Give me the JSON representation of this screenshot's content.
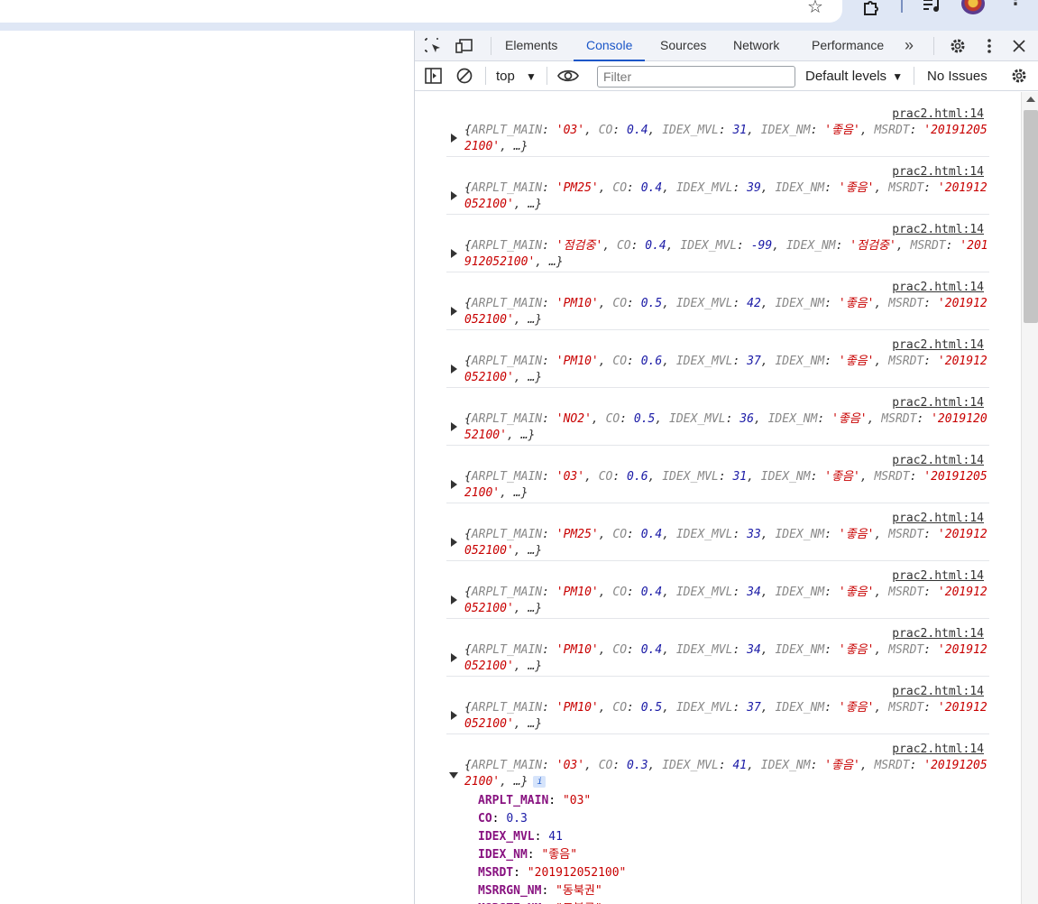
{
  "devtools": {
    "tabs": [
      "Elements",
      "Console",
      "Sources",
      "Network",
      "Performance"
    ],
    "active_tab": "Console",
    "more_tabs": "»",
    "context": "top",
    "filter_placeholder": "Filter",
    "levels": "Default levels",
    "issues": "No Issues"
  },
  "console": {
    "messages": [
      {
        "source": "prac2.html:14",
        "main": "'03'",
        "co": "0.4",
        "idx": "31",
        "nm": "'좋음'",
        "msrdt": "'201912052100'"
      },
      {
        "source": "prac2.html:14",
        "main": "'PM25'",
        "co": "0.4",
        "idx": "39",
        "nm": "'좋음'",
        "msrdt": "'201912052100'"
      },
      {
        "source": "prac2.html:14",
        "main": "'점검중'",
        "co": "0.4",
        "idx": "-99",
        "nm": "'점검중'",
        "msrdt": "'201912052100'"
      },
      {
        "source": "prac2.html:14",
        "main": "'PM10'",
        "co": "0.5",
        "idx": "42",
        "nm": "'좋음'",
        "msrdt": "'201912052100'"
      },
      {
        "source": "prac2.html:14",
        "main": "'PM10'",
        "co": "0.6",
        "idx": "37",
        "nm": "'좋음'",
        "msrdt": "'201912052100'"
      },
      {
        "source": "prac2.html:14",
        "main": "'NO2'",
        "co": "0.5",
        "idx": "36",
        "nm": "'좋음'",
        "msrdt": "'201912052100'"
      },
      {
        "source": "prac2.html:14",
        "main": "'03'",
        "co": "0.6",
        "idx": "31",
        "nm": "'좋음'",
        "msrdt": "'201912052100'"
      },
      {
        "source": "prac2.html:14",
        "main": "'PM25'",
        "co": "0.4",
        "idx": "33",
        "nm": "'좋음'",
        "msrdt": "'201912052100'"
      },
      {
        "source": "prac2.html:14",
        "main": "'PM10'",
        "co": "0.4",
        "idx": "34",
        "nm": "'좋음'",
        "msrdt": "'201912052100'"
      },
      {
        "source": "prac2.html:14",
        "main": "'PM10'",
        "co": "0.4",
        "idx": "34",
        "nm": "'좋음'",
        "msrdt": "'201912052100'"
      },
      {
        "source": "prac2.html:14",
        "main": "'PM10'",
        "co": "0.5",
        "idx": "37",
        "nm": "'좋음'",
        "msrdt": "'201912052100'"
      }
    ],
    "expanded": {
      "source": "prac2.html:14",
      "summary": {
        "main": "'03'",
        "co": "0.3",
        "idx": "41",
        "nm": "'좋음'",
        "msrdt": "'201912052100'"
      },
      "props": [
        {
          "key": "ARPLT_MAIN",
          "value": "\"03\"",
          "type": "string"
        },
        {
          "key": "CO",
          "value": "0.3",
          "type": "number"
        },
        {
          "key": "IDEX_MVL",
          "value": "41",
          "type": "number"
        },
        {
          "key": "IDEX_NM",
          "value": "\"좋음\"",
          "type": "string"
        },
        {
          "key": "MSRDT",
          "value": "\"201912052100\"",
          "type": "string"
        },
        {
          "key": "MSRRGN_NM",
          "value": "\"동북권\"",
          "type": "string"
        },
        {
          "key": "MSRSTE_NM",
          "value": "\"도봉구\"",
          "type": "string"
        }
      ]
    }
  }
}
